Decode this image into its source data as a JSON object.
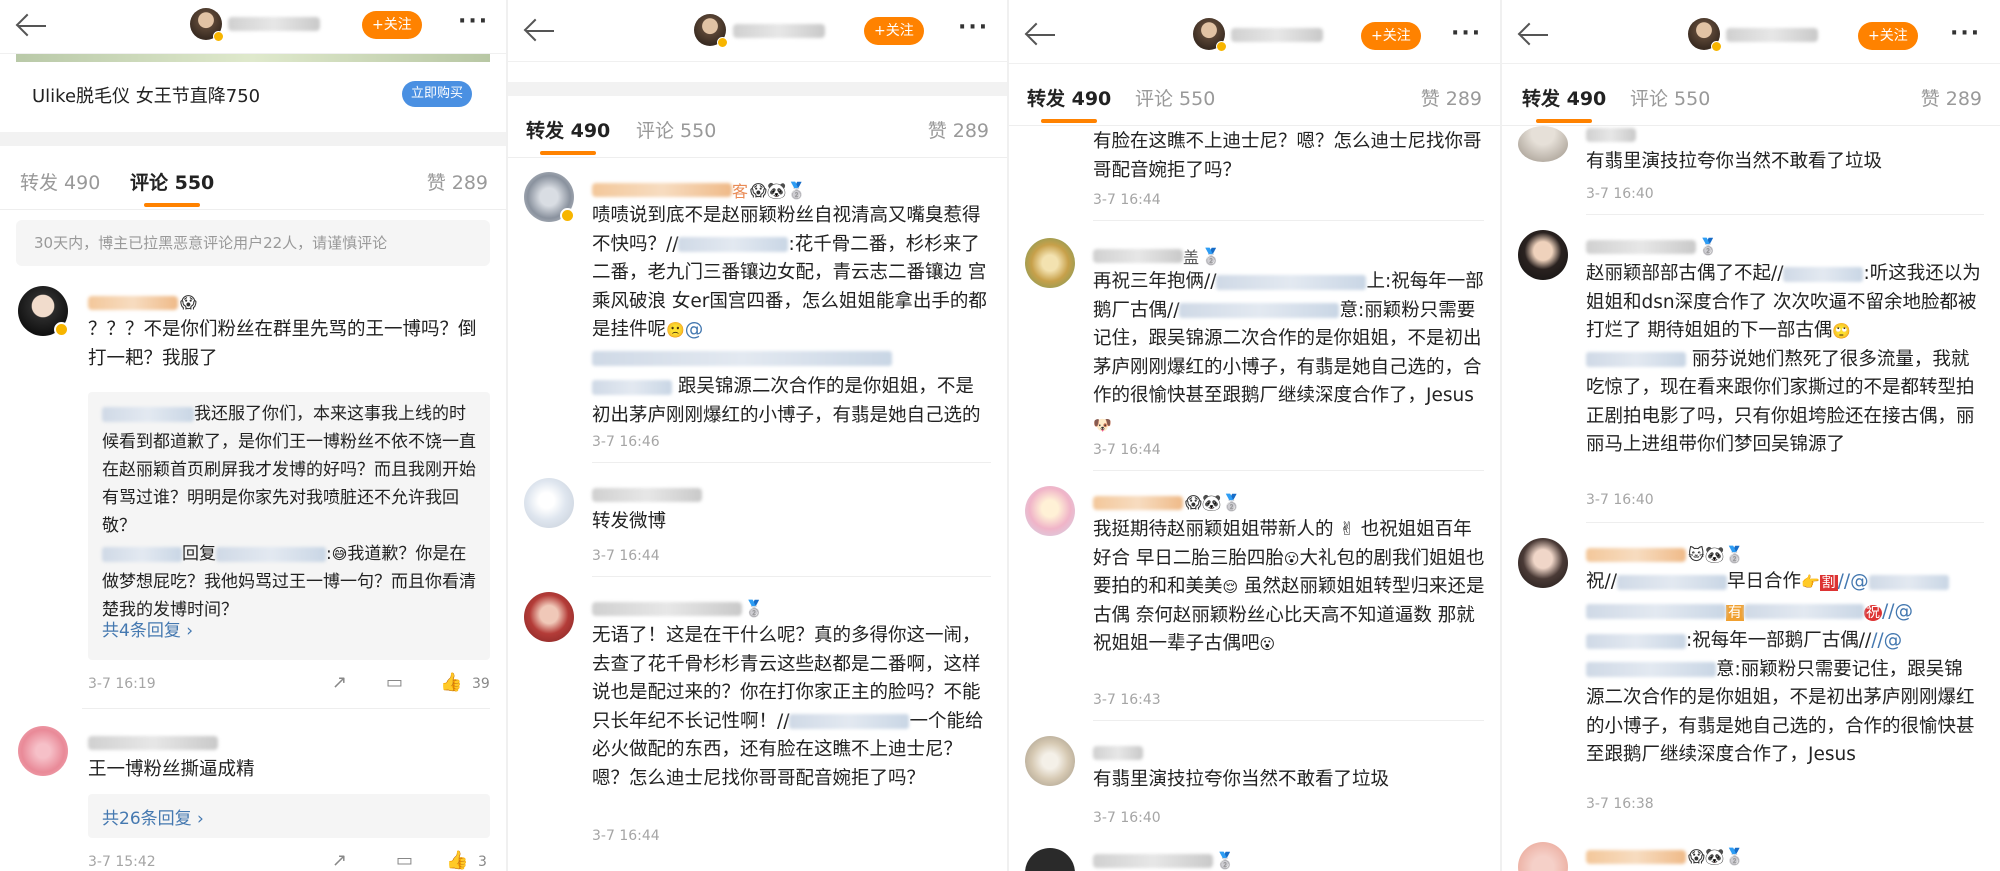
{
  "panel1": {
    "follow_label": "+关注",
    "more_label": "···",
    "ad_text": "Ulike脱毛仪 女王节直降750",
    "ad_buy": "立即购买",
    "tab_repost": "转发 490",
    "tab_comment": "评论 550",
    "likes": "赞 289",
    "notice": "30天内，博主已拉黑恶意评论用户22人，请谨慎评论",
    "c1_body": "？？？不是你们粉丝在群里先骂的王一博吗？倒打一耙？我服了",
    "c1_r1": "我还服了你们，本来这事我上线的时候看到都道歉了，是你们王一博粉丝不依不饶一直在赵丽颖首页刷屏我才发博的好吗？而且我刚开始有骂过谁？明明是你家先对我喷脏还不允许我回敬？",
    "c1_r2a": "回复",
    "c1_r2b": ":",
    "c1_r2c": "我道歉？你是在做梦想屁吃？我他妈骂过王一博一句？而且你看清楚我的发博时间？",
    "c1_more": "共4条回复 ›",
    "c1_time": "3-7 16:19",
    "c1_likes": "39",
    "c2_body": "王一博粉丝撕逼成精",
    "c2_more": "共26条回复 ›",
    "c2_time": "3-7 15:42",
    "c2_likes": "3"
  },
  "panel2": {
    "follow_label": "+关注",
    "more_label": "···",
    "tab_repost": "转发 490",
    "tab_comment": "评论 550",
    "likes": "赞 289",
    "c1_name_suffix": "客",
    "c1_body_a": "啧啧说到底不是赵丽颖粉丝自视清高又嘴臭惹得不快吗？//",
    "c1_body_b": ":花千骨二番，杉杉来了二番，老九门三番镶边女配，青云志二番镶边 宫 乘风破浪 女er国宫四番，怎么姐姐能拿出手的都是挂件呢",
    "c1_body_c": "跟吴锦源二次合作的是你姐姐，不是初出茅庐刚刚爆红的小博子，有翡是她自己选的",
    "c1_time": "3-7 16:46",
    "c2_body": "转发微博",
    "c2_time": "3-7 16:44",
    "c3_body_a": "无语了！这是在干什么呢？真的多得你这一闹，去查了花千骨杉杉青云这些赵都是二番啊，这样说也是配过来的？你在打你家正主的脸吗？不能只长年纪不长记性啊！//",
    "c3_body_b": "一个能给必火做配的东西，还有脸在这瞧不上迪士尼？嗯？怎么迪士尼找你哥哥配音婉拒了吗？",
    "c3_time": "3-7 16:44"
  },
  "panel3": {
    "follow_label": "+关注",
    "more_label": "···",
    "tab_repost": "转发 490",
    "tab_comment": "评论 550",
    "likes": "赞 289",
    "c0_body": "有脸在这瞧不上迪士尼？嗯？怎么迪士尼找你哥哥配音婉拒了吗？",
    "c0_time": "3-7 16:44",
    "c1_name_suffix": "盖",
    "c1_body_a": "再祝三年抱俩//",
    "c1_body_b": "上:祝每年一部鹅厂古偶//",
    "c1_body_c": "意:丽颖粉只需要记住，跟吴锦源二次合作的是你姐姐，不是初出茅庐刚刚爆红的小博子，有翡是她自己选的，合作的很愉快甚至跟鹅厂继续深度合作了，Jesus",
    "c1_time": "3-7 16:44",
    "c2_body": "我挺期待赵丽颖姐姐带新人的 ✌ 也祝姐姐百年好合 早日二胎三胎四胎",
    "c2_body_b": "大礼包的剧我们姐姐也要拍的和和美美",
    "c2_body_c": " 虽然赵丽颖姐姐转型归来还是古偶 奈何赵丽颖粉丝心比天高不知道逼数 那就祝姐姐一辈子古偶吧",
    "c2_time": "3-7 16:43",
    "c3_body": "有翡里演技拉夸你当然不敢看了垃圾",
    "c3_time": "3-7 16:40"
  },
  "panel4": {
    "follow_label": "+关注",
    "more_label": "···",
    "tab_repost": "转发 490",
    "tab_comment": "评论 550",
    "likes": "赞 289",
    "c0_body": "有翡里演技拉夸你当然不敢看了垃圾",
    "c0_time": "3-7 16:40",
    "c1_body_a": "赵丽颖部部古偶了不起//",
    "c1_body_b": ":听这我还以为姐姐和dsn深度合作了 次次吹逼不留余地脸都被打烂了 期待姐姐的下一部古偶",
    "c1_body_c": "丽芬说她们熬死了很多流量，我就吃惊了，现在看来跟你们家撕过的不是都转型拍正剧拍电影了吗，只有你姐垮脸还在接古偶，丽丽马上进组带你们梦回吴锦源了",
    "c1_time": "3-7 16:40",
    "c2_body_a": "祝//",
    "c2_body_b": "早日合作",
    "c2_body_c": ":祝每年一部鹅厂古偶//",
    "c2_body_d": "意:丽颖粉只需要记住，跟吴锦源二次合作的是你姐姐，不是初出茅庐刚刚爆红的小博子，有翡是她自己选的，合作的很愉快甚至跟鹅厂继续深度合作了，Jesus",
    "c2_tag1": "割",
    "c2_tag2": "有",
    "c2_tag3": "祝",
    "c2_time": "3-7 16:38"
  }
}
